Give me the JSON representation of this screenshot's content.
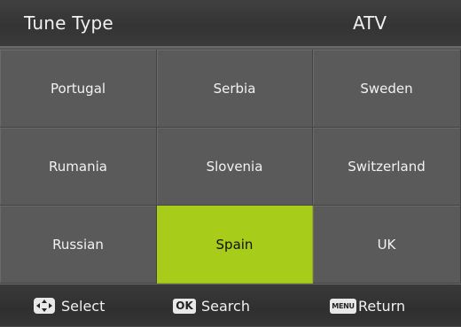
{
  "header": {
    "title": "Tune Type",
    "value": "ATV"
  },
  "countries": [
    {
      "label": "Portugal",
      "selected": false
    },
    {
      "label": "Serbia",
      "selected": false
    },
    {
      "label": "Sweden",
      "selected": false
    },
    {
      "label": "Rumania",
      "selected": false
    },
    {
      "label": "Slovenia",
      "selected": false
    },
    {
      "label": "Switzerland",
      "selected": false
    },
    {
      "label": "Russian",
      "selected": false
    },
    {
      "label": "Spain",
      "selected": true
    },
    {
      "label": "UK",
      "selected": false
    }
  ],
  "footer": {
    "select": {
      "icon": "dpad-icon",
      "label": "Select"
    },
    "search": {
      "key": "OK",
      "label": "Search"
    },
    "return": {
      "key": "MENU",
      "label": "Return"
    }
  },
  "colors": {
    "selected": "#a8cc1a",
    "cell": "#5a5a5a",
    "bar": "#353535"
  }
}
